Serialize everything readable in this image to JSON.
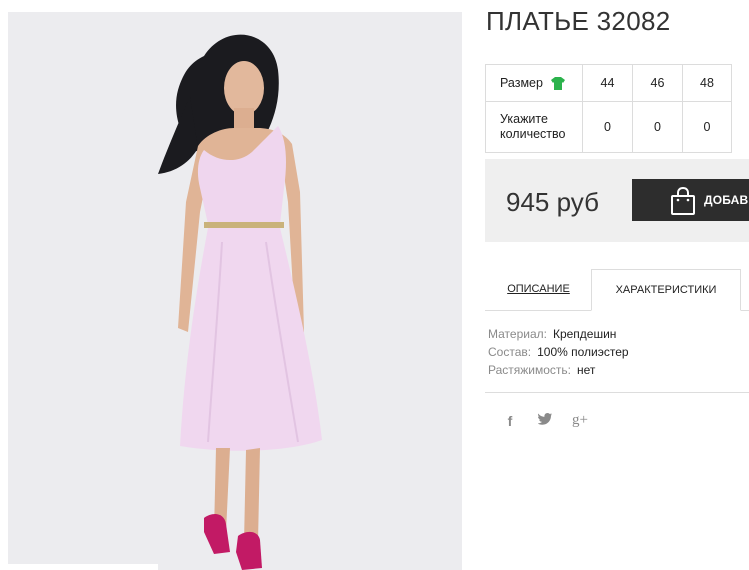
{
  "product": {
    "title": "ПЛАТЬЕ 32082",
    "image_icon": "dress-photo",
    "sizes": {
      "size_label": "Размер",
      "size_icon": "tshirt-icon",
      "quantity_label": "Укажите количество",
      "columns": [
        {
          "size": "44",
          "qty": "0"
        },
        {
          "size": "46",
          "qty": "0"
        },
        {
          "size": "48",
          "qty": "0"
        }
      ]
    },
    "price": "945 руб",
    "add_button_label": "ДОБАВИ",
    "add_button_icon": "shopping-bag-icon",
    "accent_color": "#2d2d2d",
    "size_icon_color": "#2bb24c"
  },
  "tabs": [
    {
      "label": "ОПИСАНИЕ",
      "active": false
    },
    {
      "label": "ХАРАКТЕРИСТИКИ",
      "active": true
    }
  ],
  "specs": [
    {
      "label": "Материал:",
      "value": "Крепдешин"
    },
    {
      "label": "Состав:",
      "value": "100% полиэстер"
    },
    {
      "label": "Растяжимость:",
      "value": "нет"
    }
  ],
  "social": [
    {
      "name": "facebook-icon",
      "glyph": "f"
    },
    {
      "name": "twitter-icon",
      "glyph": "🐦"
    },
    {
      "name": "google-plus-icon",
      "glyph": "g+"
    }
  ]
}
